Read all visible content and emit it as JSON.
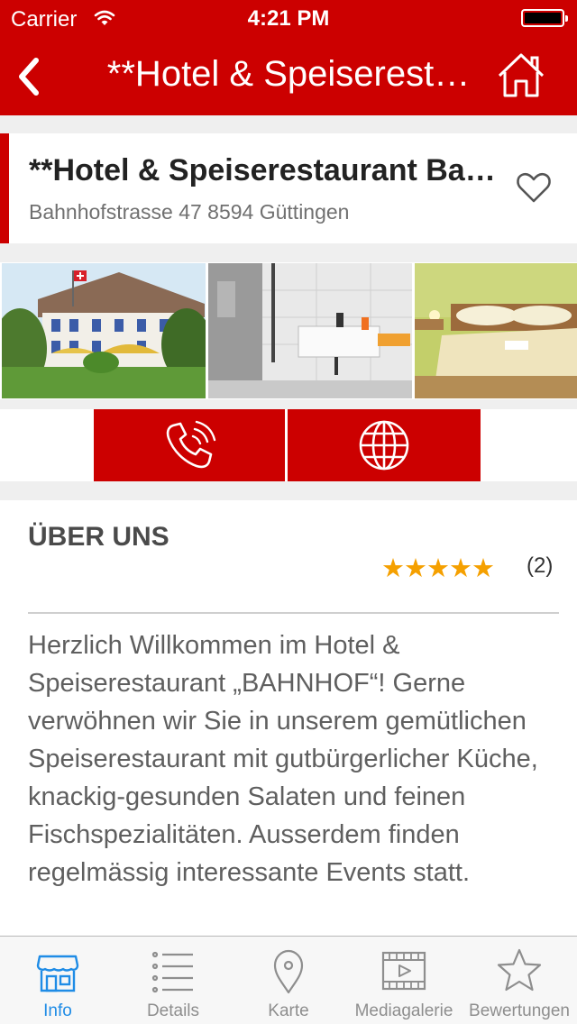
{
  "status_bar": {
    "carrier": "Carrier",
    "time": "4:21 PM"
  },
  "nav": {
    "title": "**Hotel & Speiserest…",
    "back_icon": "chevron-left-icon",
    "home_icon": "home-icon"
  },
  "header": {
    "name": "**Hotel & Speiserestaurant Ba…",
    "address": "Bahnhofstrasse 47 8594  Güttingen",
    "favorite_icon": "heart-icon"
  },
  "gallery": {
    "photos": [
      "hotel-exterior-photo",
      "bathroom-photo",
      "bedroom-photo"
    ]
  },
  "actions": {
    "call_icon": "phone-icon",
    "web_icon": "globe-icon"
  },
  "about": {
    "title": "ÜBER UNS",
    "stars": "★★★★★",
    "rating": 5,
    "rating_count": "(2)",
    "description": "Herzlich Willkommen im Hotel & Speiserestaurant „BAHNHOF“! Gerne verwöhnen wir Sie in unserem gemütlichen Speiserestaurant mit gutbürgerlicher Küche, knackig-gesunden Salaten und feinen Fischspezialitäten. Ausserdem finden regelmässig interessante Events statt."
  },
  "tabs": [
    {
      "label": "Info",
      "icon": "store-icon",
      "active": true
    },
    {
      "label": "Details",
      "icon": "list-icon",
      "active": false
    },
    {
      "label": "Karte",
      "icon": "map-pin-icon",
      "active": false
    },
    {
      "label": "Mediagalerie",
      "icon": "film-icon",
      "active": false
    },
    {
      "label": "Bewertungen",
      "icon": "star-icon",
      "active": false
    }
  ],
  "colors": {
    "brand": "#cc0000",
    "star": "#f5a000",
    "tab_active": "#1f8ce6",
    "tab_inactive": "#8e8e8e"
  }
}
